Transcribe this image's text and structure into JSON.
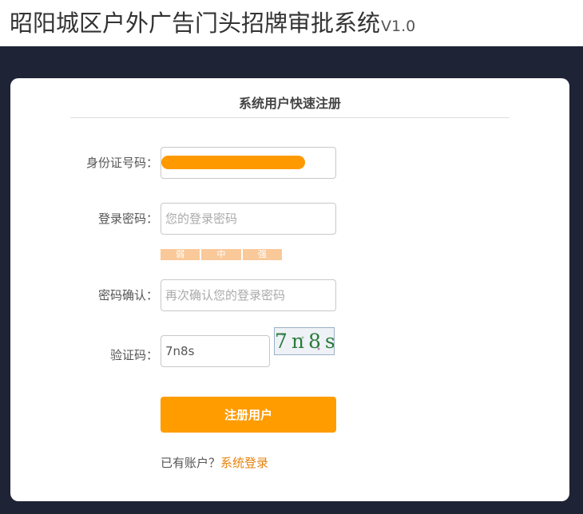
{
  "header": {
    "title": "昭阳城区户外广告门头招牌审批系统",
    "version": "V1.0"
  },
  "form": {
    "title": "系统用户快速注册",
    "id_number": {
      "label": "身份证号码："
    },
    "password": {
      "label": "登录密码：",
      "placeholder": "您的登录密码"
    },
    "strength_levels": [
      "弱",
      "中",
      "强"
    ],
    "confirm_password": {
      "label": "密码确认：",
      "placeholder": "再次确认您的登录密码"
    },
    "captcha": {
      "label": "验证码：",
      "value": "7n8s",
      "image_text": "7n8s"
    },
    "submit_label": "注册用户",
    "login_prompt": "已有账户？",
    "login_link": "系统登录"
  },
  "colors": {
    "accent": "#ff9c00",
    "link": "#e6820e",
    "background": "#1f2336",
    "redaction": "#ff9900"
  }
}
